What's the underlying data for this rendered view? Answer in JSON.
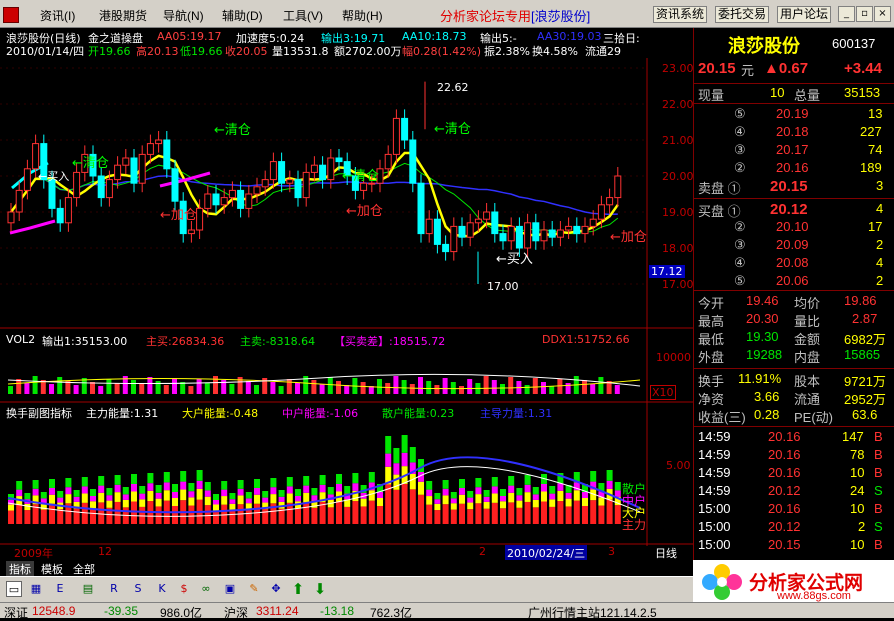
{
  "menu": {
    "items": [
      "资讯(I)",
      "港股期货",
      "导航(N)",
      "辅助(D)",
      "工具(V)",
      "帮助(H)"
    ],
    "brand_prefix": "分析家论坛专用",
    "brand_stock": "[浪莎股份]",
    "sys_buttons": [
      "资讯系统",
      "委托交易",
      "用户论坛"
    ]
  },
  "main": {
    "line1": {
      "title": "浪莎股份(日线)",
      "indicator": "金之道操盘",
      "aa05": "AA05:19.17",
      "accel": "加速度5:0.24",
      "out3": "输出3:19.71",
      "aa10": "AA10:18.73",
      "out5": "输出5:-",
      "aa30": "AA30:19.03",
      "tail": "三拾日:"
    },
    "line2": {
      "date": "2010/01/14/四",
      "open": "开19.66",
      "high": "高20.13",
      "low": "低19.66",
      "close": "收20.05",
      "vol": "量13531.8",
      "amount": "额2702.00万",
      "range": "幅0.28(1.42%)",
      "swing": "振2.38%",
      "turnover": "换4.58%",
      "float": "流通29"
    },
    "price_axis": [
      "23.00",
      "22.00",
      "21.00",
      "20.00",
      "19.00",
      "18.00",
      "17.00"
    ],
    "current_price_tag": "17.12",
    "annotations": {
      "peak": "22.62",
      "trough": "17.00",
      "clear1": "清仓",
      "clear2": "清仓",
      "clear3": "清仓",
      "clear4": "清仓",
      "add1": "加仓",
      "add2": "加仓",
      "add3": "加仓",
      "buy1": "买入",
      "buy2": "买入"
    },
    "vol_line": {
      "label": "VOL2",
      "out1": "输出1:35153.00",
      "main_buy": "主买:26834.36",
      "main_sell": "主卖:-8318.64",
      "diff": "【买卖差】:18515.72",
      "ddx": "DDX1:51752.66",
      "axis": "10000",
      "multiplier": "X10"
    },
    "sub_line": {
      "label": "换手副图指标",
      "main_power": "主力能量:1.31",
      "big_power": "大户能量:-0.48",
      "mid_power": "中户能量:-1.06",
      "retail_power": "散户能量:0.23",
      "lead_power": "主导力量:1.31",
      "axis": "5.00",
      "side_labels": [
        "散户",
        "中户",
        "大户",
        "主力"
      ]
    },
    "time_axis": {
      "year": "2009年",
      "m12": "12",
      "m2": "2",
      "selected_date": "2010/02/24/三",
      "m3": "3"
    }
  },
  "right": {
    "stock_name": "浪莎股份",
    "stock_code": "600137",
    "price": "20.15",
    "price_unit": "元",
    "change": "▲0.67",
    "change_pct": "+3.44",
    "now_vol_label": "现量",
    "now_vol": "10",
    "total_vol_label": "总量",
    "total_vol": "35153",
    "asks": [
      {
        "level": "⑤",
        "price": "20.19",
        "vol": "13"
      },
      {
        "level": "④",
        "price": "20.18",
        "vol": "227"
      },
      {
        "level": "③",
        "price": "20.17",
        "vol": "74"
      },
      {
        "level": "②",
        "price": "20.16",
        "vol": "189"
      },
      {
        "level": "卖盘 ①",
        "price": "20.15",
        "vol": "3"
      }
    ],
    "bids": [
      {
        "level": "买盘 ①",
        "price": "20.12",
        "vol": "4"
      },
      {
        "level": "②",
        "price": "20.10",
        "vol": "17"
      },
      {
        "level": "③",
        "price": "20.09",
        "vol": "2"
      },
      {
        "level": "④",
        "price": "20.08",
        "vol": "4"
      },
      {
        "level": "⑤",
        "price": "20.06",
        "vol": "2"
      }
    ],
    "stats": [
      {
        "l1": "今开",
        "v1": "19.46",
        "l2": "均价",
        "v2": "19.86"
      },
      {
        "l1": "最高",
        "v1": "20.30",
        "l2": "量比",
        "v2": "2.87"
      },
      {
        "l1": "最低",
        "v1": "19.30",
        "l2": "金额",
        "v2": "6982万"
      },
      {
        "l1": "外盘",
        "v1": "19288",
        "l2": "内盘",
        "v2": "15865"
      }
    ],
    "stats2": [
      {
        "l1": "换手",
        "v1": "11.91%",
        "l2": "股本",
        "v2": "9721万"
      },
      {
        "l1": "净资",
        "v1": "3.66",
        "l2": "流通",
        "v2": "2952万"
      },
      {
        "l1": "收益(三)",
        "v1": "0.28",
        "l2": "PE(动)",
        "v2": "63.6"
      }
    ],
    "ticks": [
      {
        "time": "14:59",
        "price": "20.16",
        "vol": "147",
        "side": "B"
      },
      {
        "time": "14:59",
        "price": "20.16",
        "vol": "78",
        "side": "B"
      },
      {
        "time": "14:59",
        "price": "20.16",
        "vol": "10",
        "side": "B"
      },
      {
        "time": "14:59",
        "price": "20.12",
        "vol": "24",
        "side": "S"
      },
      {
        "time": "15:00",
        "price": "20.16",
        "vol": "10",
        "side": "B"
      },
      {
        "time": "15:00",
        "price": "20.12",
        "vol": "2",
        "side": "S"
      },
      {
        "time": "15:00",
        "price": "20.15",
        "vol": "10",
        "side": "B"
      }
    ]
  },
  "bottom": {
    "tabs": [
      "指标",
      "模板",
      "全部"
    ],
    "timeframe": "日线"
  },
  "logo": {
    "main": "分析家公式网",
    "url": "www.88gs.com"
  },
  "status": {
    "sz_label": "深证",
    "sz_index": "12548.9",
    "sz_change": "-39.35",
    "sz_amount": "986.0亿",
    "hs_label": "沪深",
    "hs_index": "3311.24",
    "hs_change": "-13.18",
    "hs_amount": "762.3亿",
    "server": "广州行情主站121.14.2.5"
  },
  "colors": {
    "up": "#ff3232",
    "down": "#00ffff",
    "green": "#00e600",
    "yellow": "#ffff00",
    "magenta": "#ff00ff",
    "blue": "#3030ff"
  }
}
